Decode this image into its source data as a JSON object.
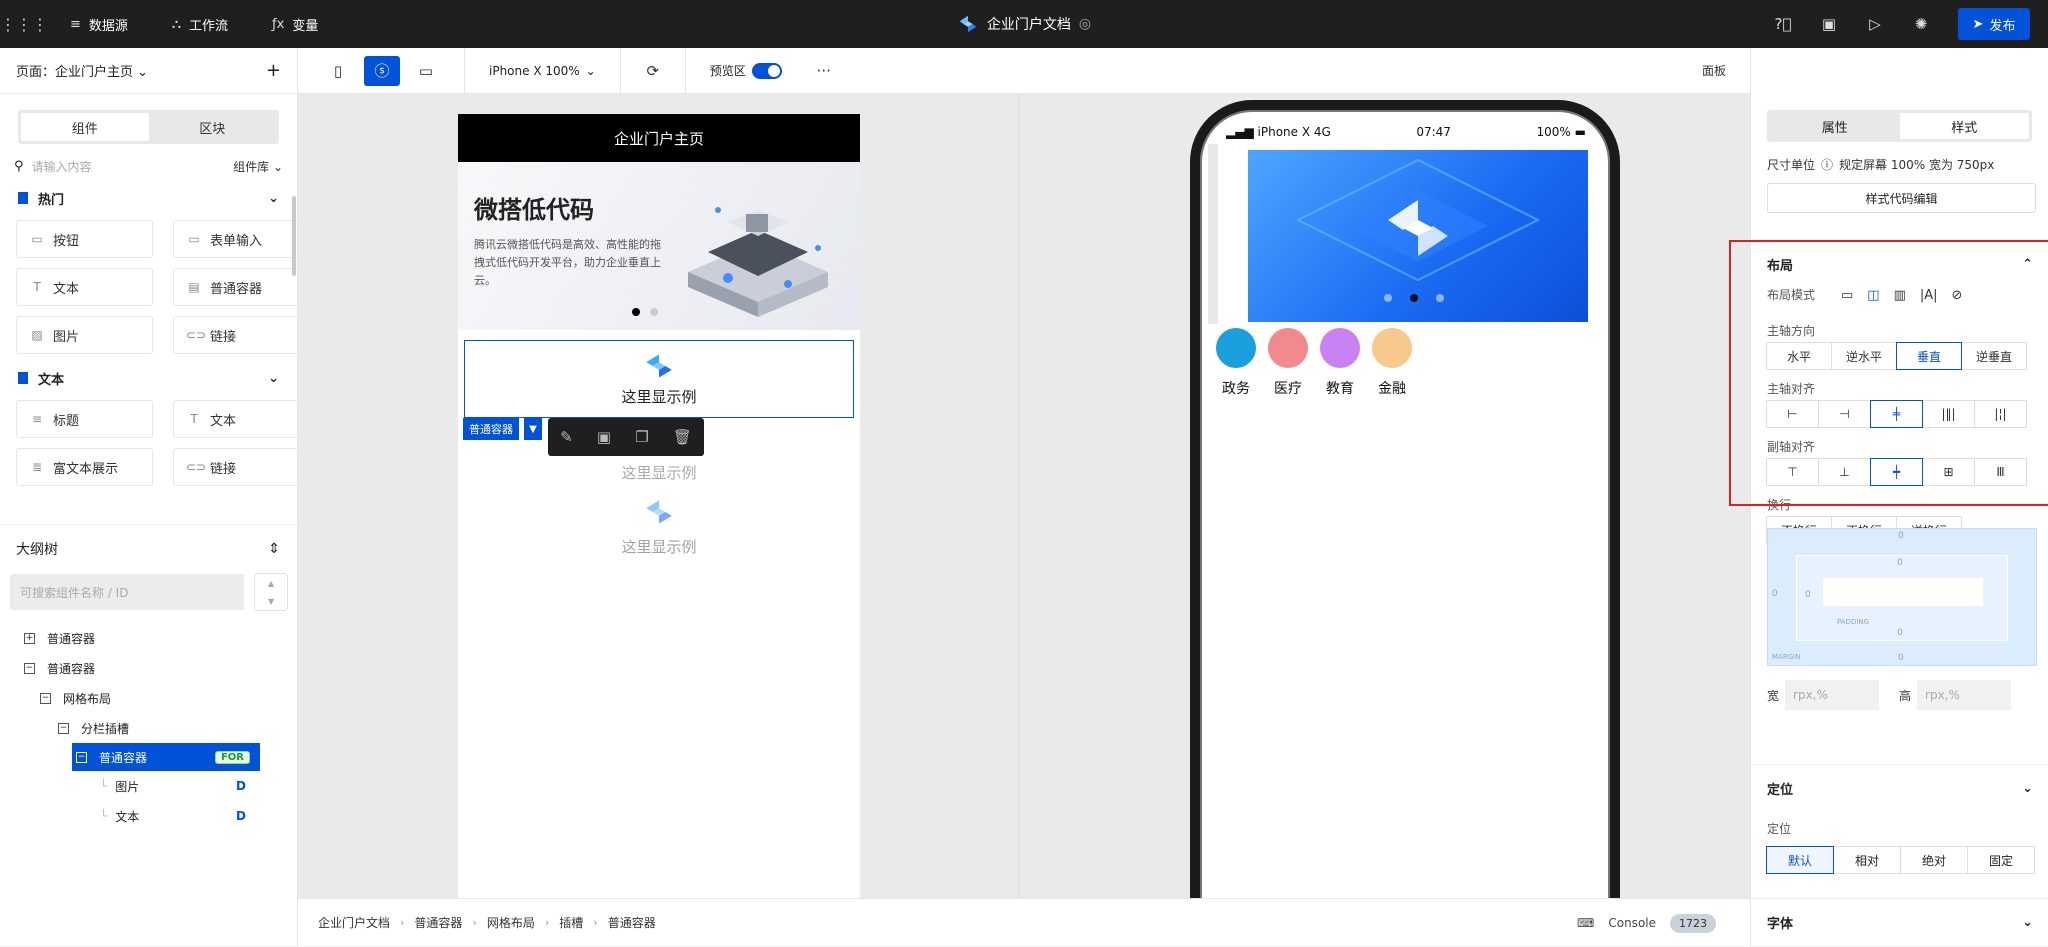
{
  "topbar": {
    "menu": [
      {
        "icon": "database-icon",
        "glyph": "≡",
        "label": "数据源"
      },
      {
        "icon": "workflow-icon",
        "glyph": "⛬",
        "label": "工作流"
      },
      {
        "icon": "function-icon",
        "glyph": "ƒx",
        "label": "变量"
      }
    ],
    "doc_title": "企业门户文档",
    "publish_label": "发布"
  },
  "left": {
    "page_label": "页面：企业门户主页",
    "tabs": [
      "组件",
      "区块"
    ],
    "search_placeholder": "请输入内容",
    "library_label": "组件库",
    "sections": [
      {
        "title": "热门",
        "items": [
          {
            "icon": "button-icon",
            "label": "按钮"
          },
          {
            "icon": "input-icon",
            "label": "表单输入"
          },
          {
            "icon": "text-icon",
            "label": "文本"
          },
          {
            "icon": "container-icon",
            "label": "普通容器"
          },
          {
            "icon": "image-icon",
            "label": "图片"
          },
          {
            "icon": "link-icon",
            "label": "链接"
          }
        ]
      },
      {
        "title": "文本",
        "items": [
          {
            "icon": "heading-icon",
            "label": "标题"
          },
          {
            "icon": "text-icon",
            "label": "文本"
          },
          {
            "icon": "richtext-icon",
            "label": "富文本展示"
          },
          {
            "icon": "link-icon",
            "label": "链接"
          }
        ]
      }
    ],
    "outline": {
      "title": "大纲树",
      "search_placeholder": "可搜索组件名称 / ID",
      "nodes": [
        {
          "label": "普通容器",
          "box": "+",
          "indent": 0
        },
        {
          "label": "普通容器",
          "box": "−",
          "indent": 0
        },
        {
          "label": "网格布局",
          "box": "−",
          "indent": 1
        },
        {
          "label": "分栏插槽",
          "box": "−",
          "indent": 2
        }
      ],
      "selected": {
        "label": "普通容器",
        "tag": "FOR"
      },
      "leaves": [
        {
          "label": "图片",
          "tag": "D"
        },
        {
          "label": "文本",
          "tag": "D"
        }
      ]
    }
  },
  "toolbar": {
    "device": "iPhone X 100%",
    "preview_label": "预览区",
    "panel_label": "面板"
  },
  "canvas": {
    "header": "企业门户主页",
    "banner_title": "微搭低代码",
    "banner_desc": "腾讯云微搭低代码是高效、高性能的拖拽式低代码开发平台，助力企业垂直上云。",
    "example_text": "这里显示例",
    "selected_tag": "普通容器"
  },
  "phone": {
    "carrier": "iPhone X  4G",
    "time": "07:47",
    "battery": "100%",
    "categories": [
      {
        "label": "政务",
        "color": "#1a9fdf"
      },
      {
        "label": "医疗",
        "color": "#f08a8f"
      },
      {
        "label": "教育",
        "color": "#c882f4"
      },
      {
        "label": "金融",
        "color": "#f7c98a"
      }
    ]
  },
  "breadcrumb": [
    "企业门户文档",
    "普通容器",
    "网格布局",
    "插槽",
    "普通容器"
  ],
  "console": {
    "label": "Console",
    "count": "1723"
  },
  "right": {
    "tabs": [
      "属性",
      "样式"
    ],
    "unit_label": "尺寸单位",
    "unit_desc": "规定屏幕 100% 宽为 750px",
    "style_code_btn": "样式代码编辑",
    "layout_title": "布局",
    "layout_mode_label": "布局模式",
    "main_dir_label": "主轴方向",
    "main_dir": [
      "水平",
      "逆水平",
      "垂直",
      "逆垂直"
    ],
    "main_align_label": "主轴对齐",
    "cross_align_label": "副轴对齐",
    "wrap_label": "换行",
    "wrap": [
      "不换行",
      "正换行",
      "逆换行"
    ],
    "box_values": {
      "mt": "0",
      "pt": "0",
      "pb": "0",
      "mb": "0",
      "ml": "0",
      "pl": "0"
    },
    "padding_tag": "PADDING",
    "margin_tag": "MARGIN",
    "width_label": "宽",
    "height_label": "高",
    "size_placeholder": "rpx,%",
    "position_title": "定位",
    "position_label": "定位",
    "position": [
      "默认",
      "相对",
      "绝对",
      "固定"
    ],
    "font_title": "字体"
  },
  "colors": {
    "accent": "#0052d9",
    "topbar": "#1f1f1f",
    "highlight": "#e02020"
  }
}
